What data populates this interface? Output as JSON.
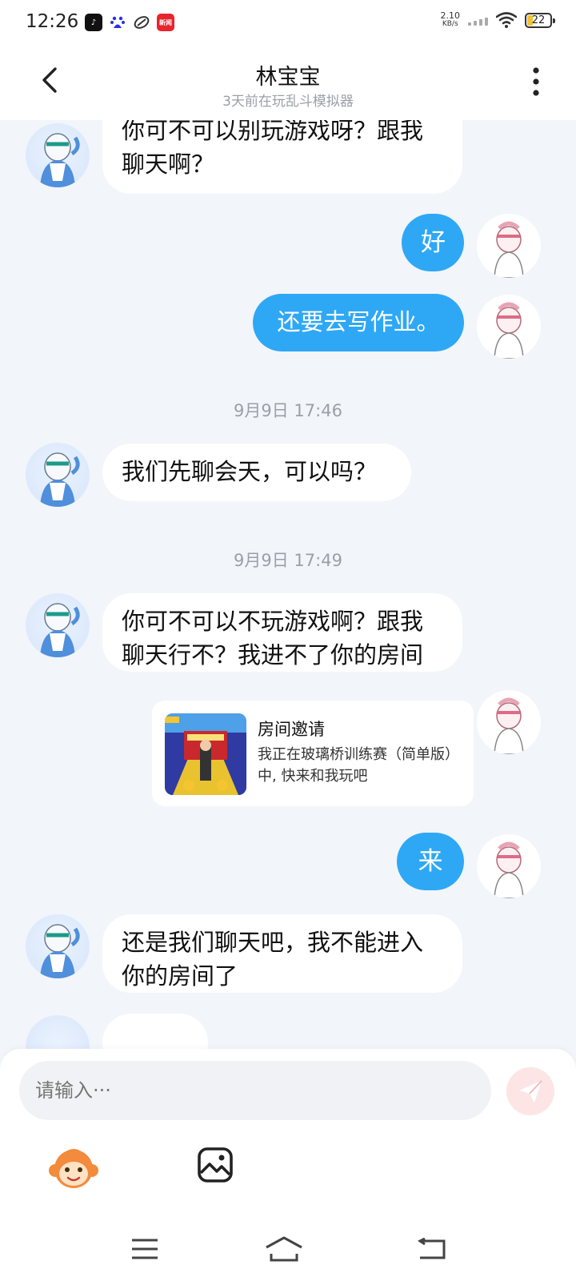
{
  "status_bar": {
    "time": "12:26",
    "net_speed_value": "2.10",
    "net_speed_unit": "KB/s",
    "battery_level": "22",
    "app_icons": [
      "tiktok-icon",
      "baidu-icon",
      "weibo-icon",
      "news-app-icon"
    ]
  },
  "header": {
    "title": "林宝宝",
    "subtitle": "3天前在玩乱斗模拟器"
  },
  "messages": [
    {
      "direction": "in",
      "text": "你可不可以别玩游戏呀？跟我\n聊天啊？"
    },
    {
      "direction": "out",
      "text": "好"
    },
    {
      "direction": "out",
      "text": "还要去写作业。"
    },
    {
      "type": "timestamp",
      "text": "9月9日 17:46"
    },
    {
      "direction": "in",
      "text": "我们先聊会天，可以吗？"
    },
    {
      "type": "timestamp",
      "text": "9月9日 17:49"
    },
    {
      "direction": "in",
      "text": "你可不可以不玩游戏啊？跟我\n聊天行不？我进不了你的房间"
    },
    {
      "type": "invite",
      "direction": "out",
      "title": "房间邀请",
      "desc": "我正在玻璃桥训练赛（简单版）中, 快来和我玩吧"
    },
    {
      "direction": "out",
      "text": "来"
    },
    {
      "direction": "in",
      "text": "还是我们聊天吧，我不能进入\n你的房间了"
    }
  ],
  "input": {
    "placeholder": "请输入···"
  },
  "colors": {
    "outgoing_bubble": "#2ea8f5",
    "incoming_bubble": "#ffffff",
    "background": "#f2f5fa",
    "send_button": "#fde5e6"
  }
}
